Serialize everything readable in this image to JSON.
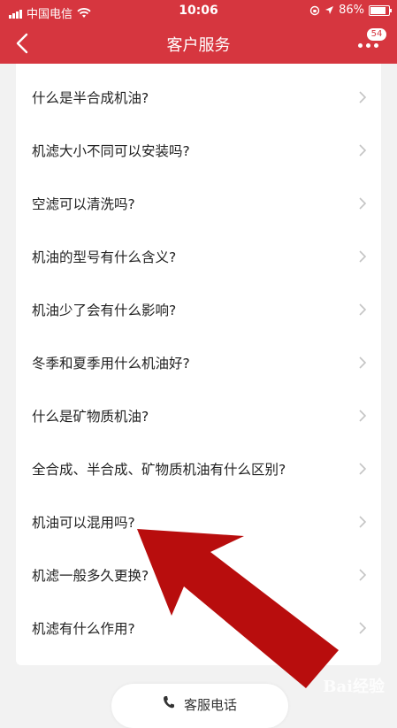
{
  "status_bar": {
    "carrier": "中国电信",
    "time": "10:06",
    "battery_percent": "86%",
    "battery_level": 0.86
  },
  "nav": {
    "title": "客户服务",
    "badge": "54"
  },
  "faq": [
    {
      "label": "什么是半合成机油?"
    },
    {
      "label": "机滤大小不同可以安装吗?"
    },
    {
      "label": "空滤可以清洗吗?"
    },
    {
      "label": "机油的型号有什么含义?"
    },
    {
      "label": "机油少了会有什么影响?"
    },
    {
      "label": "冬季和夏季用什么机油好?"
    },
    {
      "label": "什么是矿物质机油?"
    },
    {
      "label": "全合成、半合成、矿物质机油有什么区别?"
    },
    {
      "label": "机油可以混用吗?"
    },
    {
      "label": "机滤一般多久更换?"
    },
    {
      "label": "机滤有什么作用?"
    }
  ],
  "bottom": {
    "call_label": "客服电话"
  },
  "watermark": "Bai经验",
  "colors": {
    "brand_red": "#d6363f",
    "arrow_red": "#b80d0d"
  }
}
